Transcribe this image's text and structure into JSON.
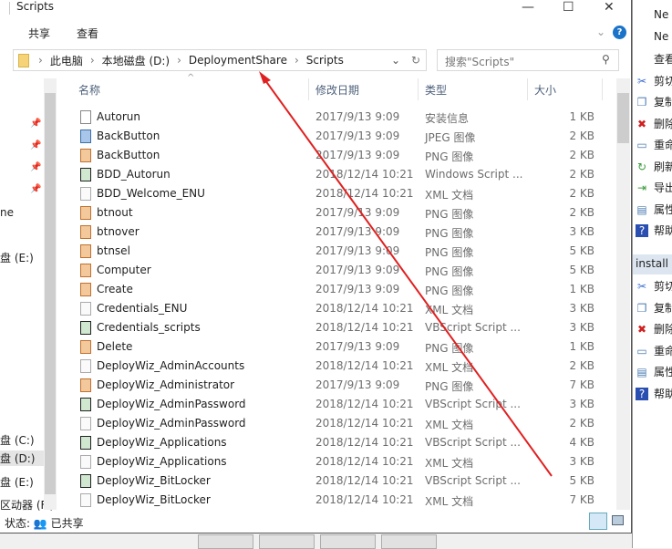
{
  "window": {
    "title": "Scripts",
    "minimize": "—",
    "maximize": "☐",
    "close": "✕"
  },
  "ribbon": {
    "tabs": [
      "共享",
      "查看"
    ],
    "expand": "⌄",
    "help": "?"
  },
  "address": {
    "crumbs": [
      "此电脑",
      "本地磁盘 (D:)",
      "DeploymentShare",
      "Scripts"
    ],
    "sep": "›",
    "dropdown": "⌄",
    "refresh": "↻"
  },
  "search": {
    "placeholder": "搜索\"Scripts\"",
    "icon": "⚲"
  },
  "columns": {
    "name": "名称",
    "date": "修改日期",
    "type": "类型",
    "size": "大小"
  },
  "nav": {
    "items": [
      "ne",
      "盘 (E:)",
      "盘 (C:)",
      "盘 (D:)",
      "盘 (E:)",
      "区动器 (F:)"
    ]
  },
  "files": [
    {
      "name": "Autorun",
      "date": "2017/9/13 9:09",
      "type": "安装信息",
      "size": "1 KB",
      "icon": "inf"
    },
    {
      "name": "BackButton",
      "date": "2017/9/13 9:09",
      "type": "JPEG 图像",
      "size": "2 KB",
      "icon": "jpg"
    },
    {
      "name": "BackButton",
      "date": "2017/9/13 9:09",
      "type": "PNG 图像",
      "size": "2 KB",
      "icon": "png"
    },
    {
      "name": "BDD_Autorun",
      "date": "2018/12/14 10:21",
      "type": "Windows Script ...",
      "size": "2 KB",
      "icon": "vbs"
    },
    {
      "name": "BDD_Welcome_ENU",
      "date": "2018/12/14 10:21",
      "type": "XML 文档",
      "size": "2 KB",
      "icon": "xml"
    },
    {
      "name": "btnout",
      "date": "2017/9/13 9:09",
      "type": "PNG 图像",
      "size": "2 KB",
      "icon": "png"
    },
    {
      "name": "btnover",
      "date": "2017/9/13 9:09",
      "type": "PNG 图像",
      "size": "3 KB",
      "icon": "png"
    },
    {
      "name": "btnsel",
      "date": "2017/9/13 9:09",
      "type": "PNG 图像",
      "size": "5 KB",
      "icon": "png"
    },
    {
      "name": "Computer",
      "date": "2017/9/13 9:09",
      "type": "PNG 图像",
      "size": "5 KB",
      "icon": "png"
    },
    {
      "name": "Create",
      "date": "2017/9/13 9:09",
      "type": "PNG 图像",
      "size": "1 KB",
      "icon": "png"
    },
    {
      "name": "Credentials_ENU",
      "date": "2018/12/14 10:21",
      "type": "XML 文档",
      "size": "3 KB",
      "icon": "xml"
    },
    {
      "name": "Credentials_scripts",
      "date": "2018/12/14 10:21",
      "type": "VBScript Script ...",
      "size": "3 KB",
      "icon": "vbs"
    },
    {
      "name": "Delete",
      "date": "2017/9/13 9:09",
      "type": "PNG 图像",
      "size": "1 KB",
      "icon": "png"
    },
    {
      "name": "DeployWiz_AdminAccounts",
      "date": "2018/12/14 10:21",
      "type": "XML 文档",
      "size": "2 KB",
      "icon": "xml"
    },
    {
      "name": "DeployWiz_Administrator",
      "date": "2017/9/13 9:09",
      "type": "PNG 图像",
      "size": "7 KB",
      "icon": "png"
    },
    {
      "name": "DeployWiz_AdminPassword",
      "date": "2018/12/14 10:21",
      "type": "VBScript Script ...",
      "size": "3 KB",
      "icon": "vbs"
    },
    {
      "name": "DeployWiz_AdminPassword",
      "date": "2018/12/14 10:21",
      "type": "XML 文档",
      "size": "2 KB",
      "icon": "xml"
    },
    {
      "name": "DeployWiz_Applications",
      "date": "2018/12/14 10:21",
      "type": "VBScript Script ...",
      "size": "4 KB",
      "icon": "vbs"
    },
    {
      "name": "DeployWiz_Applications",
      "date": "2018/12/14 10:21",
      "type": "XML 文档",
      "size": "3 KB",
      "icon": "xml"
    },
    {
      "name": "DeployWiz_BitLocker",
      "date": "2018/12/14 10:21",
      "type": "VBScript Script ...",
      "size": "5 KB",
      "icon": "vbs"
    },
    {
      "name": "DeployWiz_BitLocker",
      "date": "2018/12/14 10:21",
      "type": "XML 文档",
      "size": "7 KB",
      "icon": "xml"
    }
  ],
  "status": {
    "label": "状态:",
    "value": "已共享"
  },
  "right_panel": {
    "items": [
      {
        "label": "Ne",
        "icon": ""
      },
      {
        "label": "Ne",
        "icon": ""
      },
      {
        "label": "查看",
        "icon": ""
      },
      {
        "label": "剪切",
        "icon": "✂"
      },
      {
        "label": "复制",
        "icon": "❐"
      },
      {
        "label": "删除",
        "icon": "✖"
      },
      {
        "label": "重命",
        "icon": "▭"
      },
      {
        "label": "刷新",
        "icon": "↻"
      },
      {
        "label": "导出",
        "icon": "⇥"
      },
      {
        "label": "属性",
        "icon": "▤"
      },
      {
        "label": "帮助",
        "icon": "?"
      }
    ],
    "section": "install w",
    "items2": [
      {
        "label": "剪切",
        "icon": "✂"
      },
      {
        "label": "复制",
        "icon": "❐"
      },
      {
        "label": "删除",
        "icon": "✖"
      },
      {
        "label": "重命",
        "icon": "▭"
      },
      {
        "label": "属性",
        "icon": "▤"
      },
      {
        "label": "帮助",
        "icon": "?"
      }
    ]
  },
  "colors": {
    "annotation_arrow": "#e02020",
    "accent": "#1a73c8"
  }
}
